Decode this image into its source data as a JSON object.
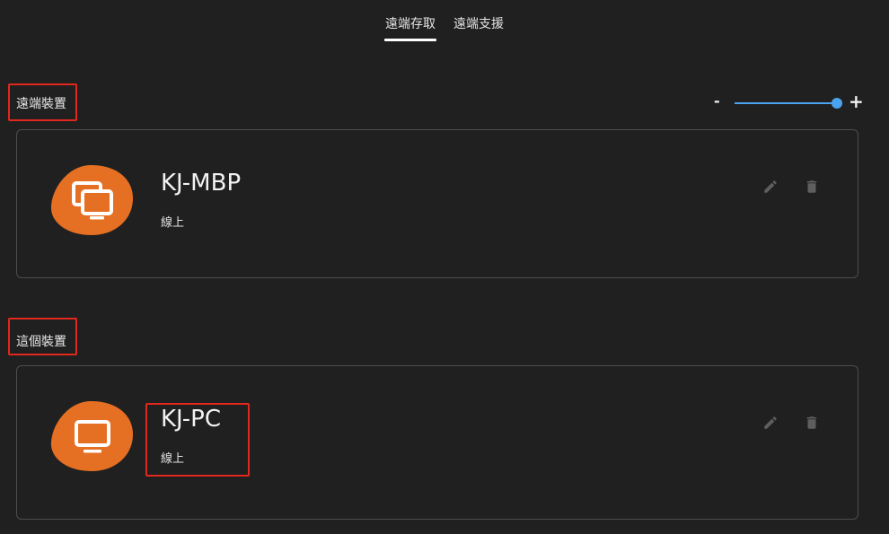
{
  "tabs": [
    {
      "label": "遠端存取",
      "active": true
    },
    {
      "label": "遠端支援",
      "active": false
    }
  ],
  "zoom": {
    "minus_label": "-",
    "plus_label": "+",
    "value_fraction": 1.0
  },
  "sections": {
    "remote": {
      "title": "遠端裝置",
      "device": {
        "name": "KJ-MBP",
        "status": "線上",
        "icon": "multi-monitor-icon"
      }
    },
    "this_device": {
      "title": "這個裝置",
      "device": {
        "name": "KJ-PC",
        "status": "線上",
        "icon": "monitor-icon"
      }
    }
  },
  "colors": {
    "background": "#202020",
    "accent_orange": "#e56f22",
    "slider_blue": "#4aa3ee",
    "annotation_red": "#e0281c",
    "card_border": "#4d4d4d"
  }
}
